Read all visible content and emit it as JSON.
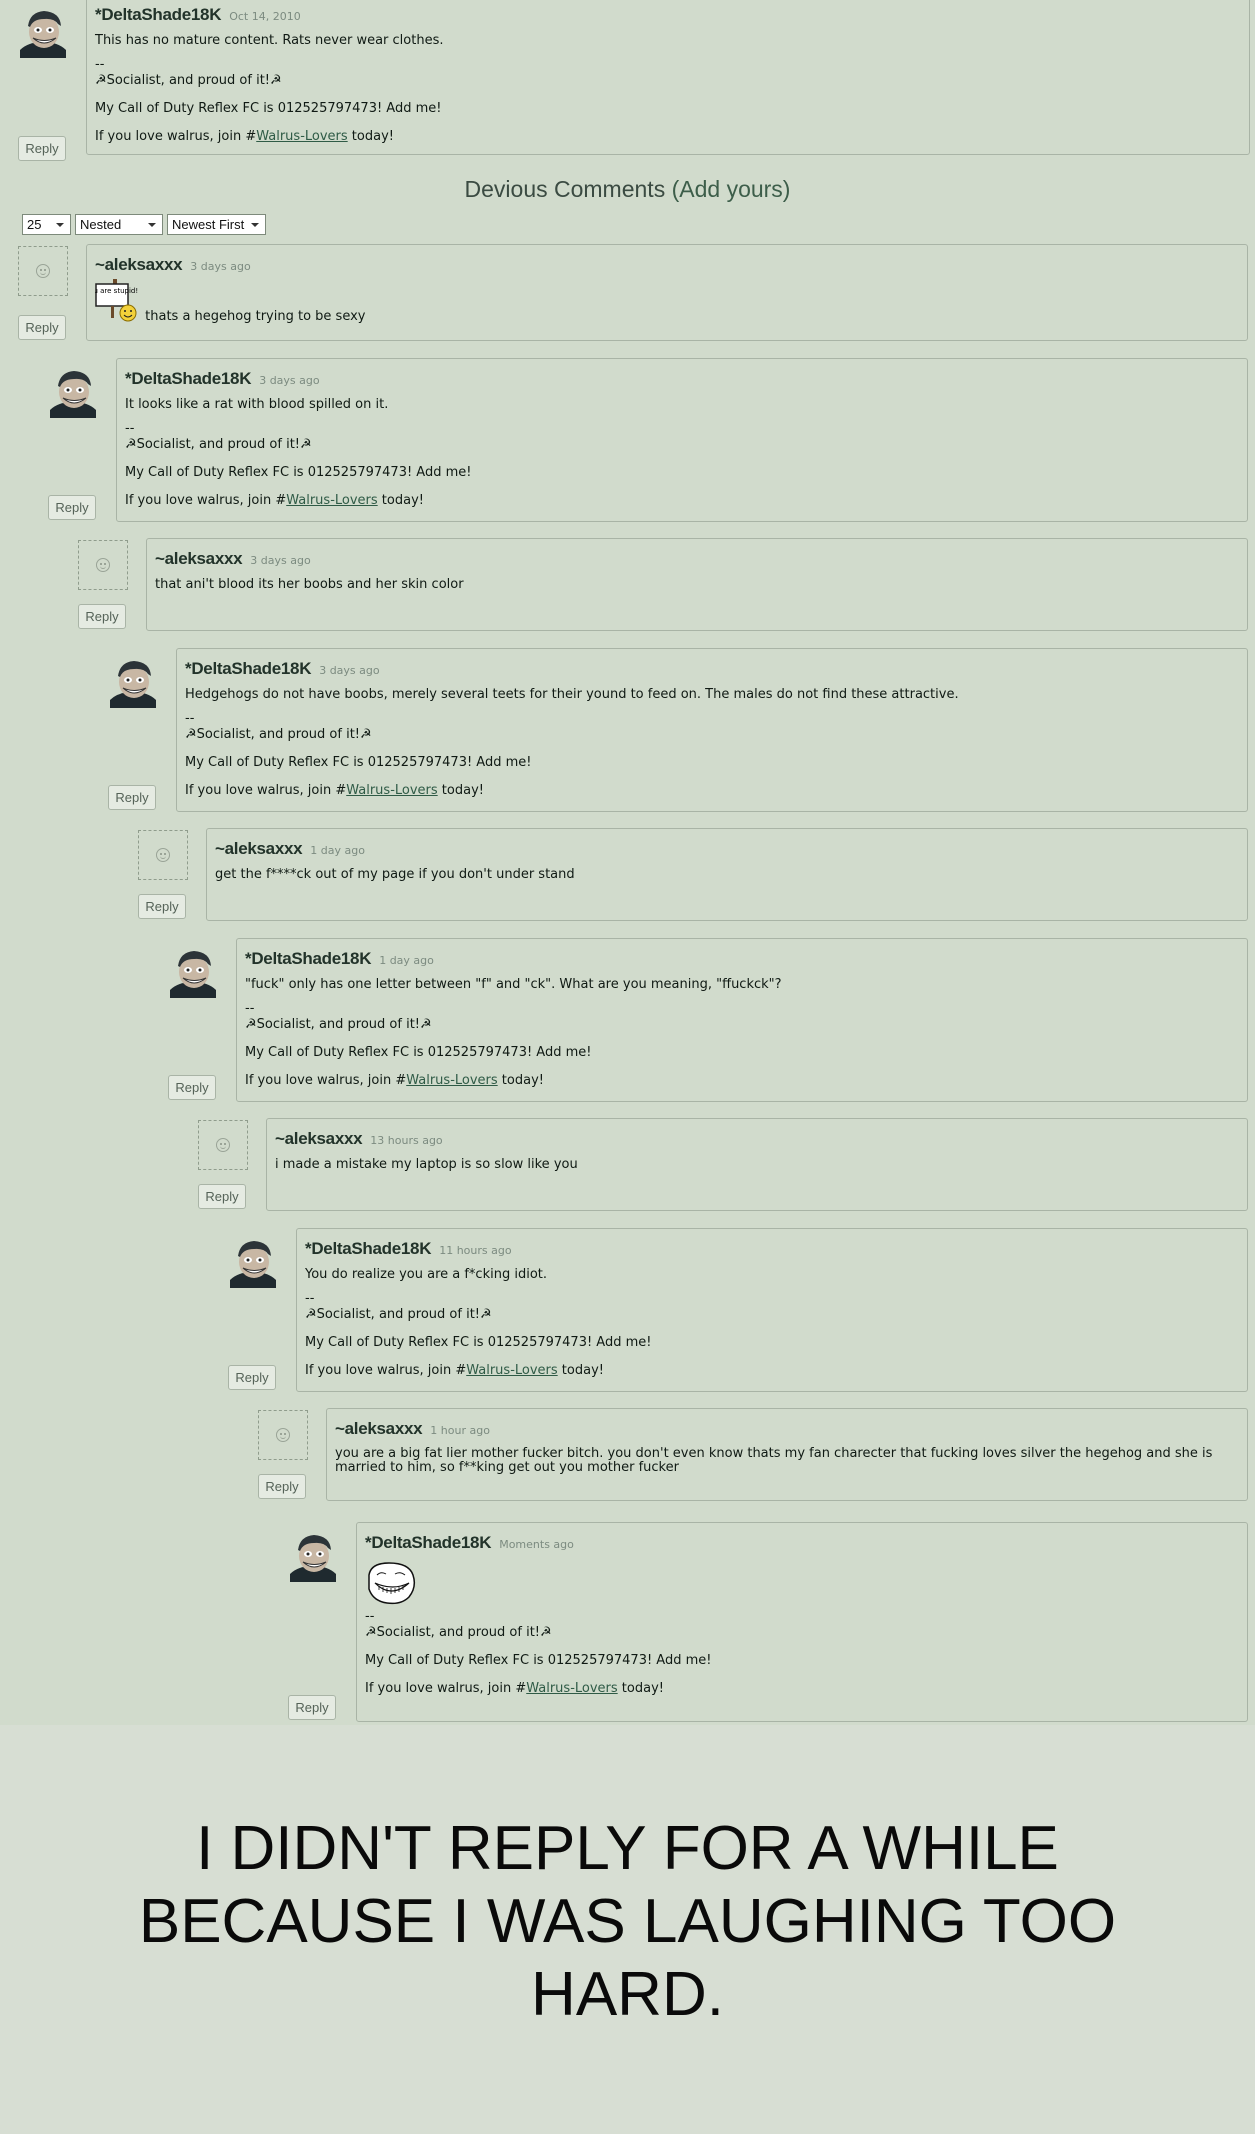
{
  "top_comment": {
    "author": "*DeltaShade18K",
    "time": "Oct 14, 2010",
    "body": "This has no mature content. Rats never wear clothes.",
    "reply": "Reply"
  },
  "signature": {
    "dashes": "--",
    "line1": "☭Socialist, and proud of it!☭",
    "line2": "My Call of Duty Reflex FC is 012525797473! Add me!",
    "line3_prefix": "If you love walrus, join #",
    "line3_link": "Walrus-Lovers",
    "line3_suffix": " today!"
  },
  "section": {
    "title": "Devious Comments",
    "add_link": "(Add yours)",
    "per_page": "25",
    "view_mode": "Nested",
    "sort_order": "Newest First"
  },
  "comments": [
    {
      "author": "~aleksaxxx",
      "time": "3 days ago",
      "body": "thats a hegehog trying to be sexy",
      "emote": "You are stupid!",
      "reply": "Reply"
    },
    {
      "author": "*DeltaShade18K",
      "time": "3 days ago",
      "body": "It looks like a rat with blood spilled on it.",
      "reply": "Reply"
    },
    {
      "author": "~aleksaxxx",
      "time": "3 days ago",
      "body": "that ani't blood its her boobs and her skin color",
      "reply": "Reply"
    },
    {
      "author": "*DeltaShade18K",
      "time": "3 days ago",
      "body": "Hedgehogs do not have boobs, merely several teets for their yound to feed on. The males do not find these attractive.",
      "reply": "Reply"
    },
    {
      "author": "~aleksaxxx",
      "time": "1 day ago",
      "body": "get the f****ck out of my page if you don't under stand",
      "reply": "Reply"
    },
    {
      "author": "*DeltaShade18K",
      "time": "1 day ago",
      "body": "\"fuck\" only has one letter between \"f\" and \"ck\". What are you meaning, \"ffuckck\"?",
      "reply": "Reply"
    },
    {
      "author": "~aleksaxxx",
      "time": "13 hours ago",
      "body": "i made a mistake my laptop is so slow like you",
      "reply": "Reply"
    },
    {
      "author": "*DeltaShade18K",
      "time": "11 hours ago",
      "body": "You do realize you are a f*cking idiot.",
      "reply": "Reply"
    },
    {
      "author": "~aleksaxxx",
      "time": "1 hour ago",
      "body": "you are a big fat lier mother fucker bitch. you don't even know thats my fan charecter that fucking loves silver the hegehog and she is married to him, so f**king get out you mother fucker",
      "reply": "Reply"
    },
    {
      "author": "*DeltaShade18K",
      "time": "Moments ago",
      "body": "",
      "reply": "Reply"
    }
  ],
  "caption": "I DIDN'T REPLY FOR A WHILE BECAUSE I WAS LAUGHING TOO HARD.",
  "colors": {
    "background": "#d1dbcc",
    "border": "#a9b4a6",
    "link": "#2f5b46",
    "author": "#22332a"
  }
}
